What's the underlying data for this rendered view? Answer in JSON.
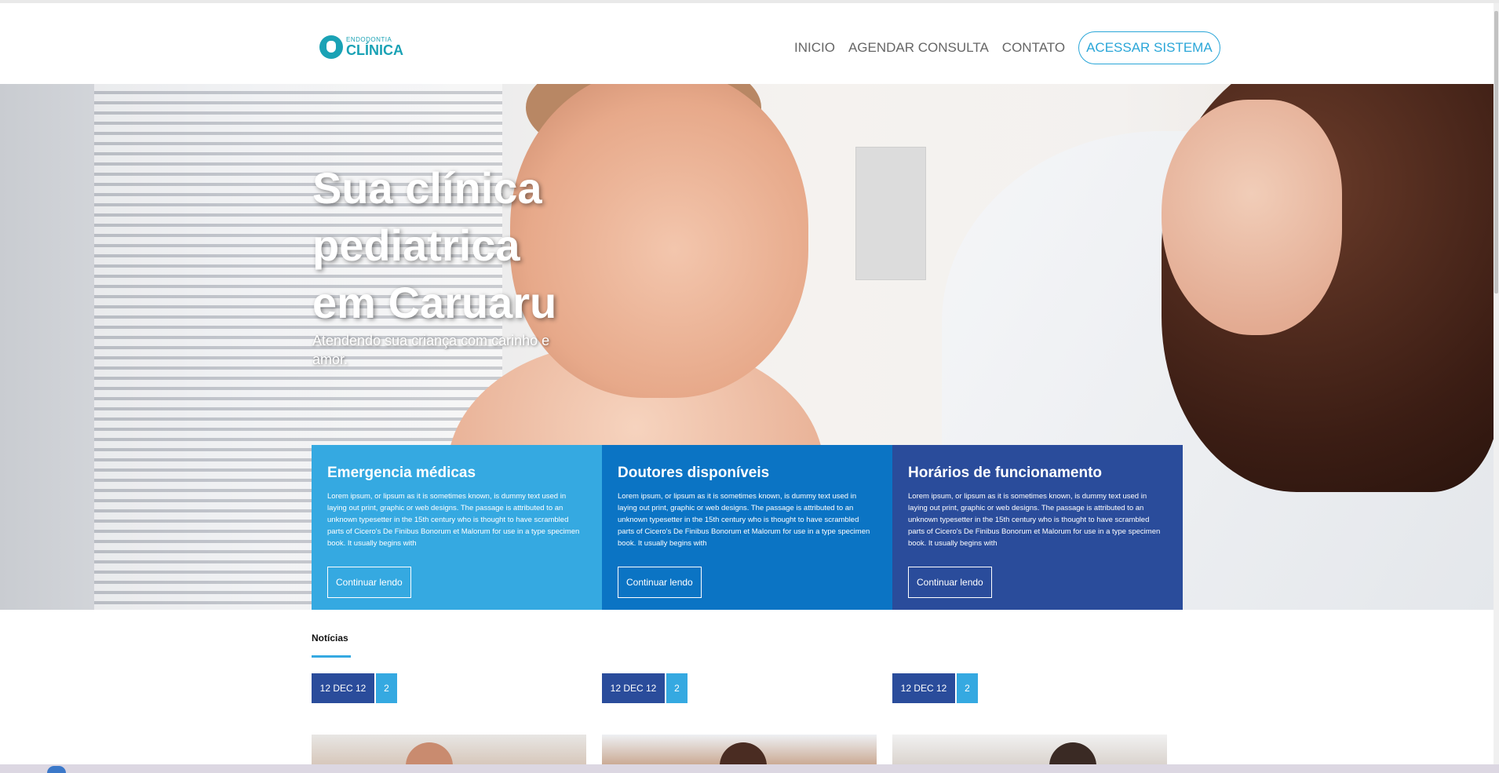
{
  "header": {
    "logo": {
      "small": "ENDODONTIA",
      "big": "CLÍNICA"
    },
    "nav": {
      "inicio": "INICIO",
      "agendar": "AGENDAR CONSULTA",
      "contato": "CONTATO",
      "acessar": "ACESSAR SISTEMA"
    }
  },
  "hero": {
    "title_lines": [
      "Sua clínica",
      "pediatrica",
      "em Caruaru"
    ],
    "subtitle": "Atendendo sua criança com carinho e amor."
  },
  "cards": [
    {
      "title": "Emergencia médicas",
      "text": "Lorem ipsum, or lipsum as it is sometimes known, is dummy text used in laying out print, graphic or web designs. The passage is attributed to an unknown typesetter in the 15th century who is thought to have scrambled parts of Cicero's De Finibus Bonorum et Malorum for use in a type specimen book. It usually begins with",
      "button": "Continuar lendo",
      "color": "#35a9e1"
    },
    {
      "title": "Doutores disponíveis",
      "text": "Lorem ipsum, or lipsum as it is sometimes known, is dummy text used in laying out print, graphic or web designs. The passage is attributed to an unknown typesetter in the 15th century who is thought to have scrambled parts of Cicero's De Finibus Bonorum et Malorum for use in a type specimen book. It usually begins with",
      "button": "Continuar lendo",
      "color": "#0b74c4"
    },
    {
      "title": "Horários de funcionamento",
      "text": "Lorem ipsum, or lipsum as it is sometimes known, is dummy text used in laying out print, graphic or web designs. The passage is attributed to an unknown typesetter in the 15th century who is thought to have scrambled parts of Cicero's De Finibus Bonorum et Malorum for use in a type specimen book. It usually begins with",
      "button": "Continuar lendo",
      "color": "#2a4c9b"
    }
  ],
  "news": {
    "title": "Notícias",
    "items": [
      {
        "date": "12 DEC 12",
        "count": "2"
      },
      {
        "date": "12 DEC 12",
        "count": "2"
      },
      {
        "date": "12 DEC 12",
        "count": "2"
      }
    ]
  },
  "theme": {
    "accent": "#35a9e1",
    "nav_button": "#2aa6d8",
    "logo": "#1aa2b5",
    "dark_blue": "#2a4c9b"
  }
}
